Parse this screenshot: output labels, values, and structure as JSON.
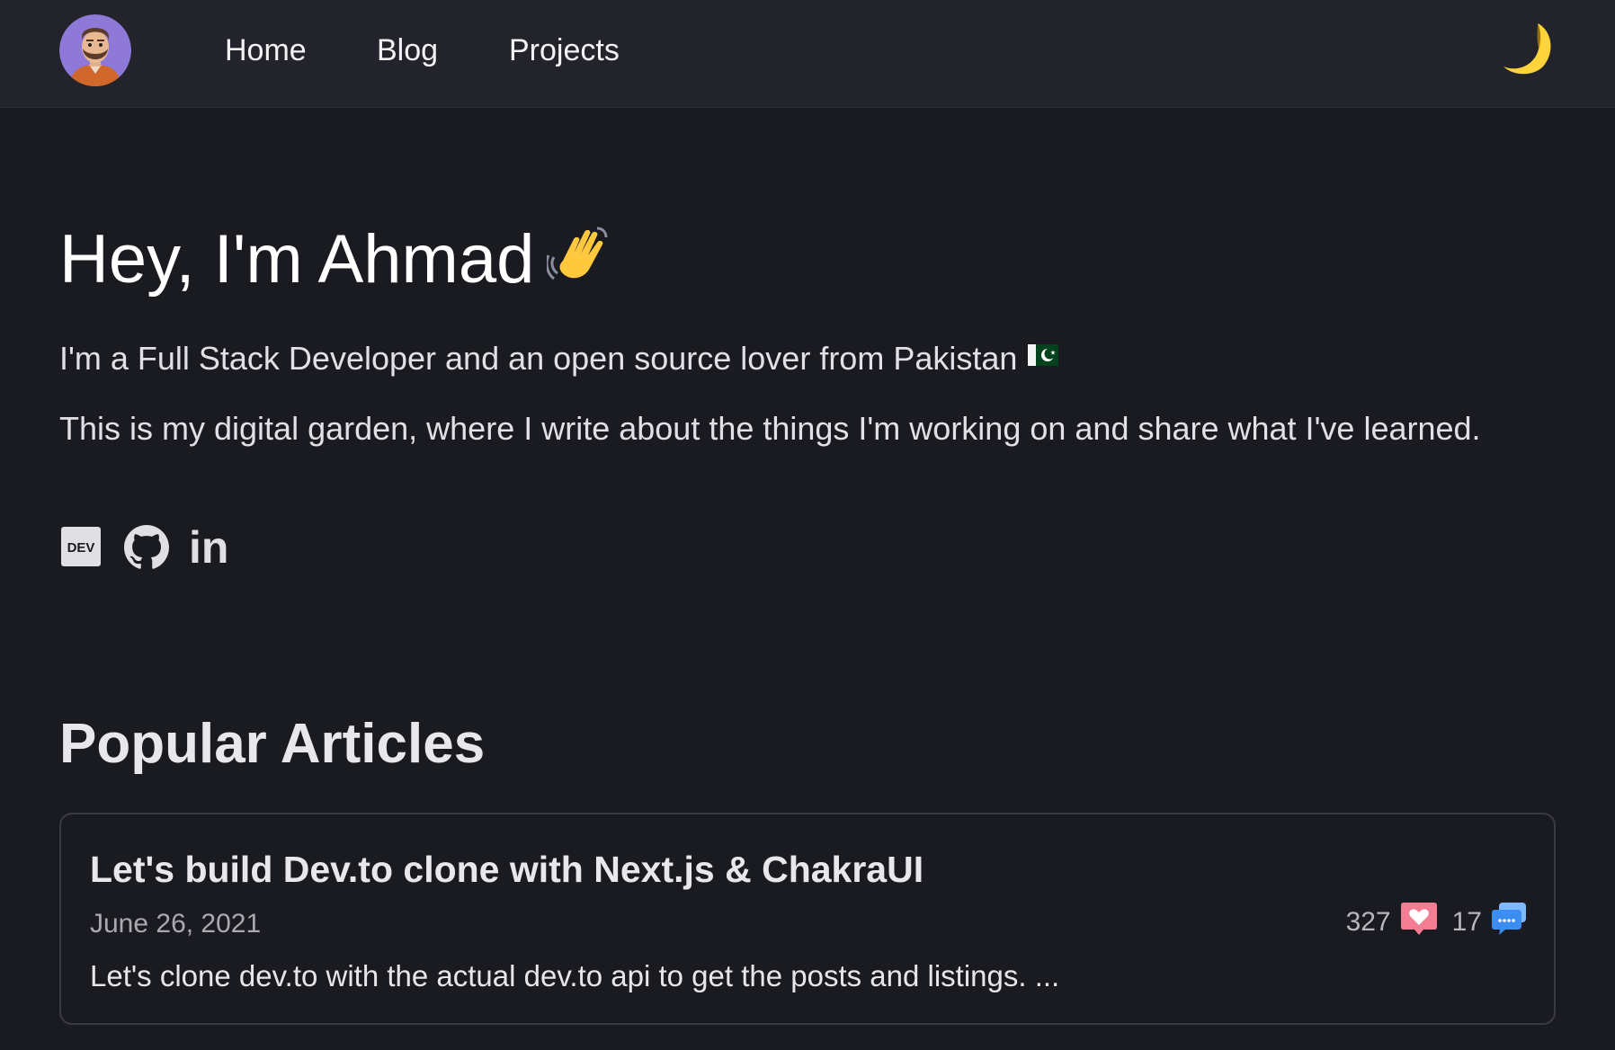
{
  "nav": {
    "links": [
      "Home",
      "Blog",
      "Projects"
    ],
    "avatar_icon": "avatar-icon",
    "theme_toggle_icon": "crescent-moon-icon"
  },
  "hero": {
    "title": "Hey, I'm Ahmad",
    "title_icon": "waving-hand-icon",
    "intro": "I'm a Full Stack Developer and an open source lover from Pakistan",
    "intro_icon": "pakistan-flag-icon",
    "garden": "This is my digital garden, where I write about the things I'm working on and share what I've learned.",
    "socials": [
      {
        "icon": "dev-icon",
        "label": "DEV"
      },
      {
        "icon": "github-icon"
      },
      {
        "icon": "linkedin-icon",
        "label": "in"
      }
    ]
  },
  "popular": {
    "heading": "Popular Articles",
    "articles": [
      {
        "title": "Let's build Dev.to clone with Next.js & ChakraUI",
        "date": "June 26, 2021",
        "reactions": "327",
        "reactions_icon": "heart-icon",
        "comments": "17",
        "comments_icon": "comment-icon",
        "excerpt": "Let's clone dev.to with the actual dev.to api to get the posts and listings. ..."
      }
    ]
  },
  "colors": {
    "background": "#1a1b20",
    "header_background": "#23242b",
    "card_border": "#3a3b42",
    "heart": "#f37d92",
    "comment": "#5aa3ff",
    "moon": "#ffd43b"
  }
}
